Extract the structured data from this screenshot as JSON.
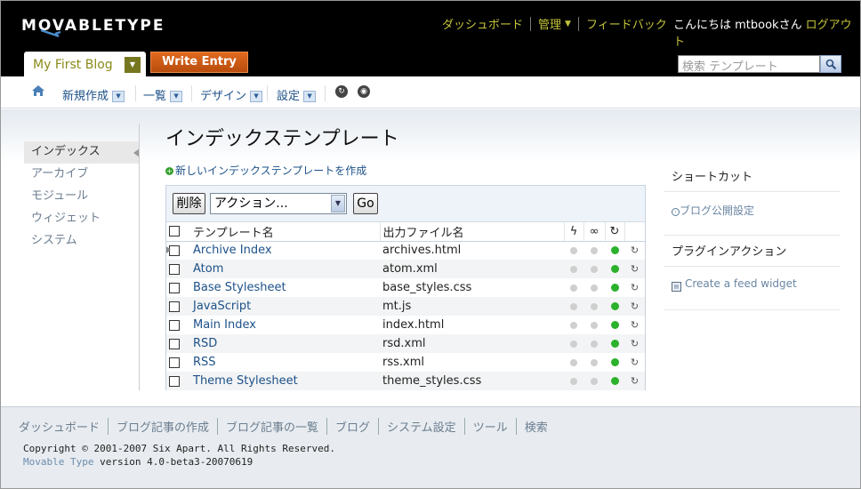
{
  "header": {
    "logo": "MOVABLETYPE",
    "nav": [
      {
        "label": "ダッシュボード"
      },
      {
        "label": "管理"
      },
      {
        "label": "フィードバック"
      }
    ],
    "greeting": "こんにちは mtbookさん",
    "logout": "ログアウト",
    "blog_name": "My First Blog",
    "write_entry": "Write Entry",
    "search_placeholder": "検索 テンプレート"
  },
  "subnav": {
    "items": [
      "新規作成",
      "一覧",
      "デザイン",
      "設定"
    ]
  },
  "sidebar": {
    "items": [
      "インデックス",
      "アーカイブ",
      "モジュール",
      "ウィジェット",
      "システム"
    ]
  },
  "main": {
    "title": "インデックステンプレート",
    "create_link": "新しいインデックステンプレートを作成",
    "delete_button": "削除",
    "action_select": "アクション...",
    "go_button": "Go",
    "columns": {
      "name": "テンプレート名",
      "file": "出力ファイル名"
    },
    "rows": [
      {
        "name": "Archive Index",
        "file": "archives.html"
      },
      {
        "name": "Atom",
        "file": "atom.xml"
      },
      {
        "name": "Base Stylesheet",
        "file": "base_styles.css"
      },
      {
        "name": "JavaScript",
        "file": "mt.js"
      },
      {
        "name": "Main Index",
        "file": "index.html"
      },
      {
        "name": "RSD",
        "file": "rsd.xml"
      },
      {
        "name": "RSS",
        "file": "rss.xml"
      },
      {
        "name": "Theme Stylesheet",
        "file": "theme_styles.css"
      }
    ]
  },
  "right": {
    "shortcuts_title": "ショートカット",
    "shortcut_link": "ブログ公開設定",
    "plugin_title": "プラグインアクション",
    "plugin_link": "Create a feed widget"
  },
  "footer": {
    "links": [
      "ダッシュボード",
      "ブログ記事の作成",
      "ブログ記事の一覧",
      "ブログ",
      "システム設定",
      "ツール",
      "検索"
    ],
    "copyright": "Copyright © 2001-2007 Six Apart. All Rights Reserved.",
    "product": "Movable Type",
    "version": " version 4.0-beta3-20070619"
  },
  "colors": {
    "header_bg": "#000000",
    "nav_link": "#c4c43b",
    "write_entry": "#d45f17",
    "link": "#1d5189",
    "status_green": "#2bb12b"
  }
}
